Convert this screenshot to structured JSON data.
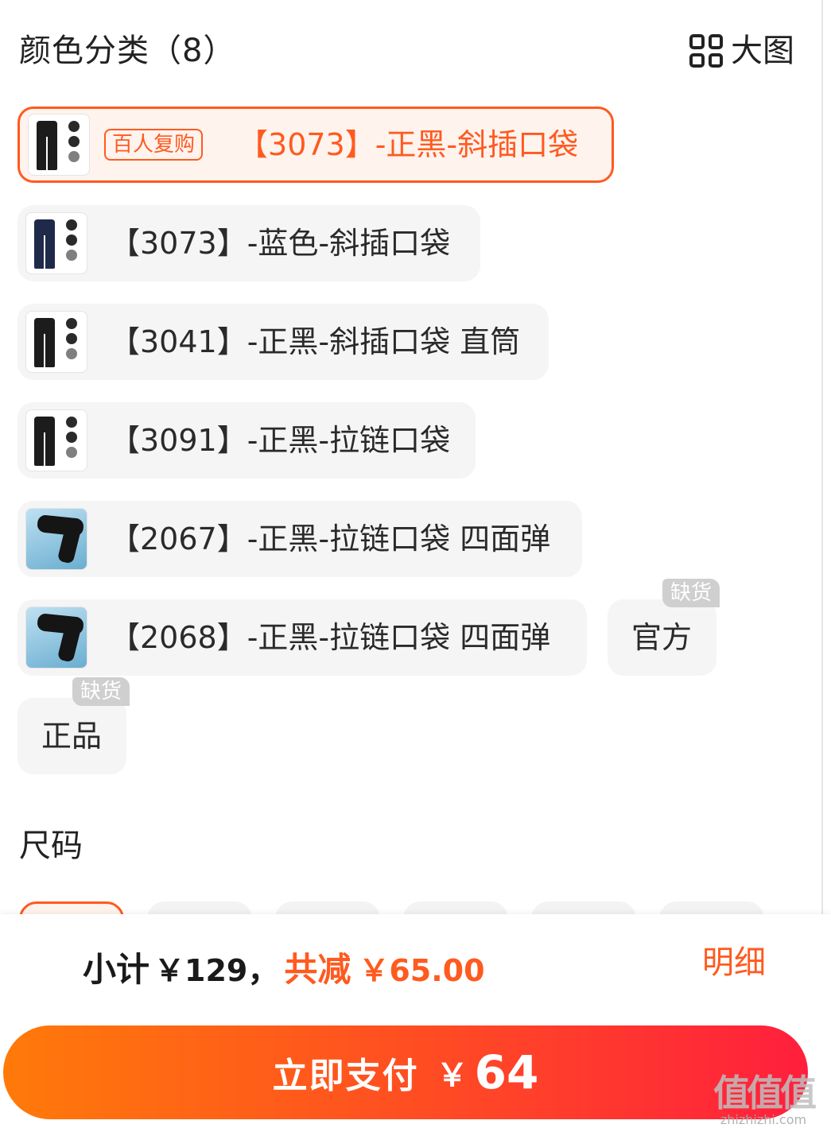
{
  "header": {
    "title": "颜色分类（8）",
    "big_view_label": "大图",
    "big_view_icon": "grid-icon"
  },
  "colors": [
    {
      "label": "【3073】-正黑-斜插口袋",
      "badge": "百人复购",
      "selected": true,
      "thumb": "pants-black"
    },
    {
      "label": "【3073】-蓝色-斜插口袋",
      "selected": false,
      "thumb": "pants-navy"
    },
    {
      "label": "【3041】-正黑-斜插口袋 直筒",
      "selected": false,
      "thumb": "pants-black"
    },
    {
      "label": "【3091】-正黑-拉链口袋",
      "selected": false,
      "thumb": "pants-black"
    },
    {
      "label": "【2067】-正黑-拉链口袋 四面弹",
      "selected": false,
      "thumb": "pants-blue-bg"
    },
    {
      "label": "【2068】-正黑-拉链口袋 四面弹",
      "selected": false,
      "thumb": "pants-blue-bg"
    },
    {
      "label": "官方",
      "selected": false,
      "out_of_stock": "缺货"
    },
    {
      "label": "正品",
      "selected": false,
      "out_of_stock": "缺货"
    }
  ],
  "size": {
    "title": "尺码"
  },
  "footer": {
    "subtotal_label": "小计",
    "subtotal_value": "￥129",
    "comma": "，",
    "discount_label": "共减",
    "discount_value": "￥65.00",
    "detail_label": "明细",
    "pay_label": "立即支付",
    "pay_currency": "￥",
    "pay_amount": "64"
  },
  "watermark": {
    "main": "值值值",
    "sub": "zhizhizhi.com"
  },
  "colors_theme": {
    "accent": "#ff5a1f",
    "chip_bg": "#f5f5f5",
    "out_of_stock_bg": "#cfcfcf"
  }
}
